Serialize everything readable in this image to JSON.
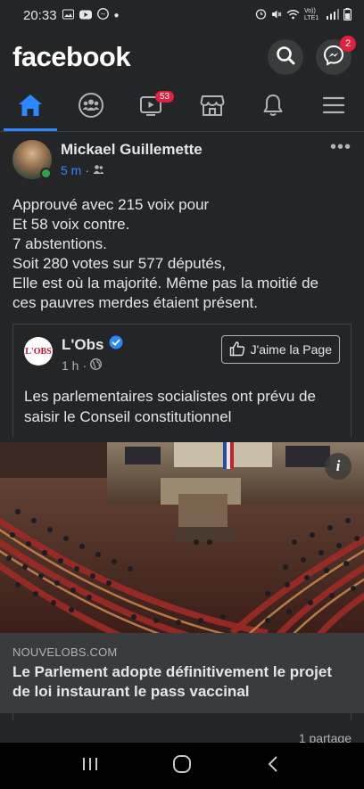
{
  "status_bar": {
    "time": "20:33",
    "network": "Vo)) LTE1",
    "icons": [
      "photo-icon",
      "youtube-icon",
      "messenger-status-icon",
      "alarm-icon",
      "mute-icon",
      "wifi-icon",
      "signal-icon",
      "battery-icon"
    ]
  },
  "header": {
    "logo": "facebook",
    "messenger_badge": "2"
  },
  "nav": {
    "tabs": [
      {
        "name": "home",
        "icon": "home-icon",
        "active": true
      },
      {
        "name": "groups",
        "icon": "groups-icon"
      },
      {
        "name": "watch",
        "icon": "video-icon",
        "badge": "53"
      },
      {
        "name": "marketplace",
        "icon": "marketplace-icon"
      },
      {
        "name": "notifications",
        "icon": "bell-icon"
      },
      {
        "name": "menu",
        "icon": "menu-icon"
      }
    ]
  },
  "post": {
    "author": "Mickael Guillemette",
    "time": "5 m",
    "privacy_icon": "friends-icon",
    "text_lines": [
      "Approuvé avec 215 voix pour",
      "Et 58 voix contre.",
      "7 abstentions.",
      "Soit 280 votes sur 577 députés,",
      "Elle est où la majorité. Même pas la moitié de",
      "ces pauvres merdes étaient présent."
    ]
  },
  "shared": {
    "logo_text": "L'OBS",
    "page_name": "L'Obs",
    "time": "1 h",
    "like_label": "J'aime la Page",
    "text": "Les parlementaires socialistes ont prévu de saisir le Conseil constitutionnel"
  },
  "link": {
    "domain": "NOUVELOBS.COM",
    "title": "Le Parlement adopte définitivement le projet de loi instaurant le pass vaccinal"
  },
  "footer": {
    "shares": "1 partage"
  },
  "colors": {
    "background": "#242526",
    "accent": "#2d88ff",
    "badge": "#e41e3f",
    "online": "#31a24c"
  }
}
